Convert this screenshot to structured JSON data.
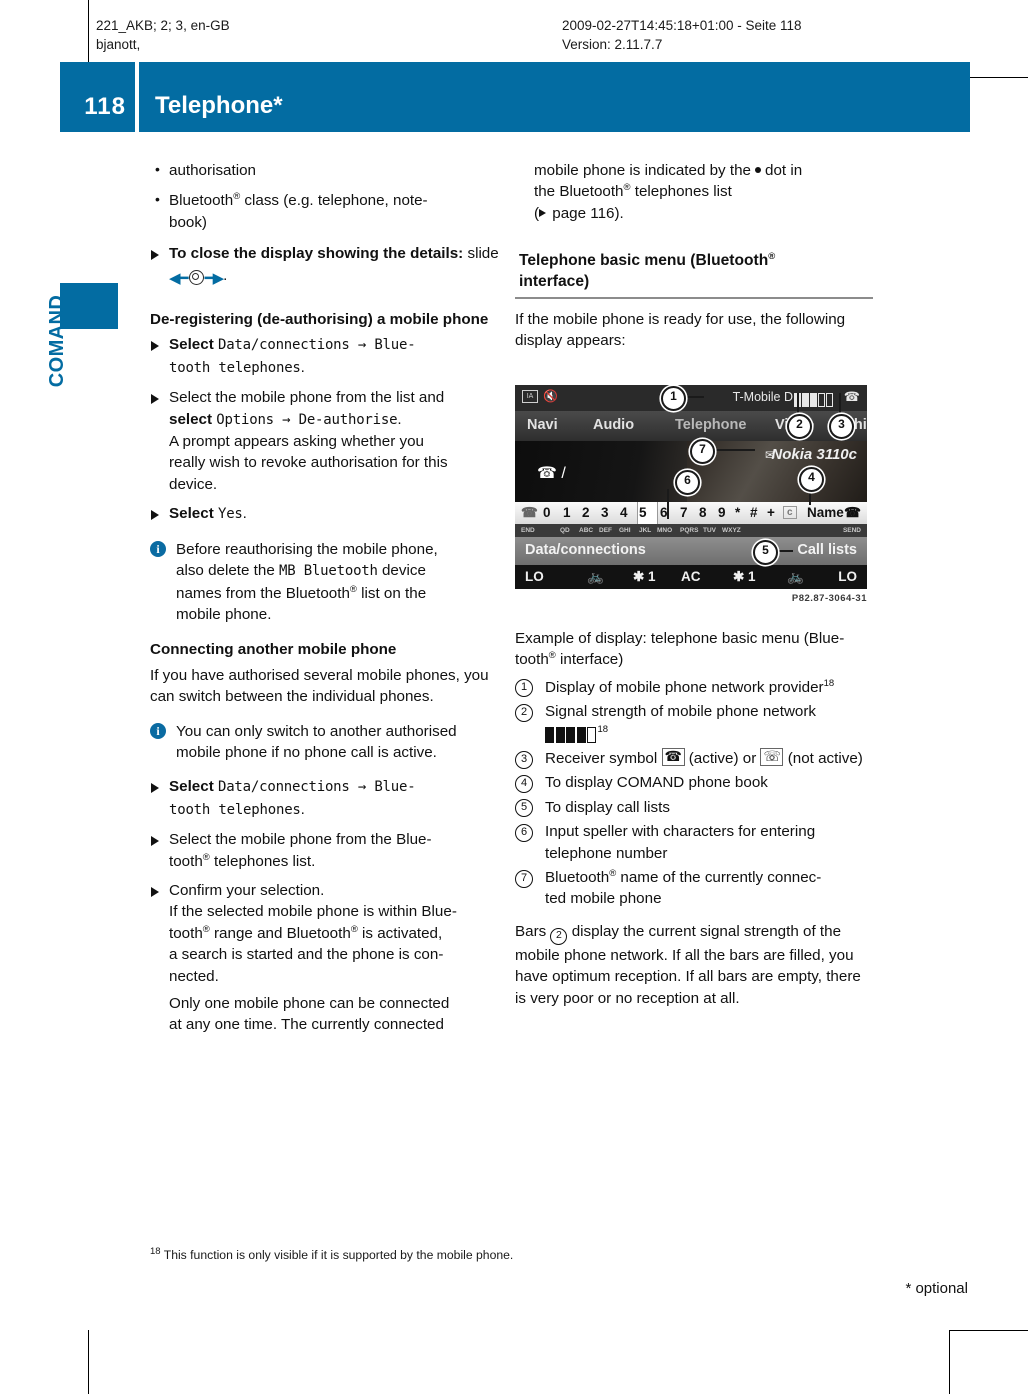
{
  "page_header": {
    "left_line1": "221_AKB; 2; 3, en-GB",
    "left_line2": "bjanott,",
    "right_line1": "2009-02-27T14:45:18+01:00 - Seite 118",
    "right_line2": "Version: 2.11.7.7"
  },
  "title_bar": {
    "page_number": "118",
    "title": "Telephone*",
    "color": "#036ca2"
  },
  "side_tab": {
    "label": "COMAND"
  },
  "left_column": {
    "bullets": [
      "authorisation",
      "Bluetooth® class (e.g. telephone, note-book)"
    ],
    "bullet_items": [
      {
        "text": "authorisation"
      },
      {
        "pre": "Bluetooth",
        "reg": "®",
        "post": " class (e.g. telephone, note-",
        "line2": "book)"
      }
    ],
    "close_step": {
      "bold": "To close the display showing the details:",
      "rest": " slide",
      "trail": "."
    },
    "heading_deregister": "De-registering (de-authorising) a mobile phone",
    "step_select_data": {
      "prefix": "Select ",
      "mono1": "Data/connections",
      "arrow": " → ",
      "mono2": "Blue-",
      "mono3": "tooth telephones",
      "end": "."
    },
    "step_select_phone": {
      "line1": "Select the mobile phone from the list and",
      "bold": "select ",
      "mono1": "Options",
      "arrow": "  → ",
      "mono2": "De-authorise",
      "end": ".",
      "cont1": "A prompt appears asking whether you",
      "cont2": "really wish to revoke authorisation for this",
      "cont3": "device."
    },
    "step_select_yes": {
      "prefix": "Select ",
      "mono": "Yes",
      "end": "."
    },
    "note_reauth": {
      "l1": "Before reauthorising the mobile phone,",
      "l2_pre": "also delete the ",
      "l2_mono": "MB Bluetooth",
      "l2_post": " device",
      "l3_pre": "names from the Bluetooth",
      "l3_post": " list on the",
      "l4": "mobile phone."
    },
    "heading_connecting": "Connecting another mobile phone",
    "para_connecting": "If you have authorised several mobile phones, you can switch between the individual phones.",
    "note_switch": {
      "l1": "You can only switch to another authorised",
      "l2": "mobile phone if no phone call is active."
    },
    "step_select_data2": {
      "prefix": "Select ",
      "mono1": "Data/connections",
      "arrow": " → ",
      "mono2": "Blue-",
      "mono3": "tooth telephones",
      "end": "."
    },
    "step_select_from_list": {
      "l1": "Select the mobile phone from the Blue-",
      "l2_pre": "tooth",
      "l2_post": " telephones list."
    },
    "step_confirm": {
      "l1": "Confirm your selection.",
      "c1": "If the selected mobile phone is within Blue-",
      "c2_a": "tooth",
      "c2_b": " range and Bluetooth",
      "c2_c": " is activated,",
      "c3": "a search is started and the phone is con-",
      "c4": "nected.",
      "c5": "Only one mobile phone can be connected",
      "c6": "at any one time. The currently connected"
    }
  },
  "right_column": {
    "cont_para": {
      "l1_a": "mobile phone is indicated by the",
      "l1_b": "dot in",
      "l2_a": "the Bluetooth",
      "l2_b": " telephones list",
      "l3_a": "(",
      "l3_b": " page 116)."
    },
    "section_heading": {
      "line1_pre": "Telephone basic menu (Bluetooth",
      "line1_reg": "®",
      "line2": "interface)"
    },
    "intro": "If the mobile phone is ready for use, the following display appears:",
    "caption": {
      "l1": "Example of display: telephone basic menu (Blue-",
      "l2_pre": "tooth",
      "l2_post": " interface)"
    },
    "callouts": [
      {
        "n": "1",
        "text": "Display of mobile phone network provider",
        "sup": "18"
      },
      {
        "n": "2",
        "text": "Signal strength of mobile phone network",
        "sup": "18",
        "has_bars": true
      },
      {
        "n": "3",
        "text": "Receiver symbol",
        "mid": "(active) or",
        "end": "(not active)",
        "has_receivers": true
      },
      {
        "n": "4",
        "text": "To display COMAND phone book"
      },
      {
        "n": "5",
        "text": "To display call lists"
      },
      {
        "n": "6",
        "text": "Input speller with characters for entering telephone number"
      },
      {
        "n": "7",
        "text": "Bluetooth® name of the currently connected mobile phone"
      }
    ],
    "callout_7_parts": {
      "pre": "Bluetooth",
      "reg": "®",
      "post": " name of the currently connec-",
      "line2": "ted mobile phone"
    },
    "bars_para": {
      "pre": "Bars",
      "num": "2",
      "post": "display the current signal strength of the mobile phone network. If all the bars are filled, you have optimum reception. If all bars are empty, there is very poor or no reception at all."
    }
  },
  "comand_screen": {
    "status": {
      "license_icon": "IA",
      "mute_icon": "mute-icon",
      "provider": "T-Mobile D",
      "signal_filled": 3,
      "signal_total": 5,
      "receiver_icon": "receiver-down-icon"
    },
    "menu": [
      "Navi",
      "Audio",
      "Telephone",
      "Video",
      "Vehicle"
    ],
    "phone_name": "Nokia 3110c",
    "call_field": "/",
    "speller_chars": [
      "0",
      "1",
      "2",
      "3",
      "4",
      "5",
      "6",
      "7",
      "8",
      "9",
      "*",
      "#",
      "+"
    ],
    "speller_selected": "6",
    "speller_left_icon": "end-call-icon",
    "speller_clear": "c",
    "speller_name_button": "Name",
    "speller_right_icon": "send-call-icon",
    "sub_labels": [
      "END",
      "QD",
      "ABC",
      "DEF",
      "GHI",
      "JKL",
      "MNO",
      "PQRS",
      "TUV",
      "WXYZ",
      "SEND"
    ],
    "bottom_left_menu": "Data/connections",
    "bottom_right_menu": "Call lists",
    "climate_row": [
      "LO",
      "seat-icon",
      "✱ 1",
      "AC",
      "✱ 1",
      "seat-icon",
      "LO"
    ],
    "image_code": "P82.87-3064-31",
    "bubbles": [
      "1",
      "2",
      "3",
      "4",
      "5",
      "6",
      "7"
    ]
  },
  "footer": {
    "footnote_marker": "18",
    "footnote_text": "This function is only visible if it is supported by the mobile phone.",
    "optional": "* optional"
  }
}
